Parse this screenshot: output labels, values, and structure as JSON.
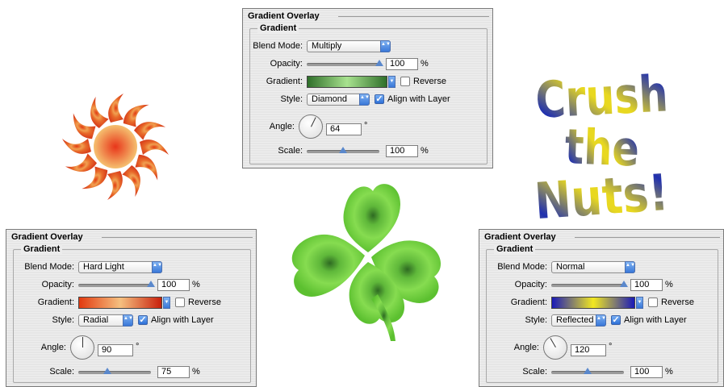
{
  "panels": [
    {
      "title": "Gradient Overlay",
      "group": "Gradient",
      "blend_label": "Blend Mode:",
      "blend_mode": "Multiply",
      "opacity_label": "Opacity:",
      "opacity": "100",
      "opacity_pct": 1.0,
      "opacity_unit": "%",
      "gradient_label": "Gradient:",
      "gradient_colors": [
        "#2f6f2a",
        "#a8e28f",
        "#2f6f2a"
      ],
      "reverse_label": "Reverse",
      "reverse_checked": false,
      "style_label": "Style:",
      "style": "Diamond",
      "align_label": "Align with Layer",
      "align_checked": true,
      "angle_label": "Angle:",
      "angle": "64",
      "degree": "°",
      "scale_label": "Scale:",
      "scale": "100",
      "scale_pct": 0.5,
      "scale_unit": "%"
    },
    {
      "title": "Gradient Overlay",
      "group": "Gradient",
      "blend_label": "Blend Mode:",
      "blend_mode": "Hard Light",
      "opacity_label": "Opacity:",
      "opacity": "100",
      "opacity_pct": 1.0,
      "opacity_unit": "%",
      "gradient_label": "Gradient:",
      "gradient_colors": [
        "#e23a10",
        "#f5c080",
        "#c8200c"
      ],
      "reverse_label": "Reverse",
      "reverse_checked": false,
      "style_label": "Style:",
      "style": "Radial",
      "align_label": "Align with Layer",
      "align_checked": true,
      "angle_label": "Angle:",
      "angle": "90",
      "degree": "°",
      "scale_label": "Scale:",
      "scale": "75",
      "scale_pct": 0.4,
      "scale_unit": "%"
    },
    {
      "title": "Gradient Overlay",
      "group": "Gradient",
      "blend_label": "Blend Mode:",
      "blend_mode": "Normal",
      "opacity_label": "Opacity:",
      "opacity": "100",
      "opacity_pct": 1.0,
      "opacity_unit": "%",
      "gradient_label": "Gradient:",
      "gradient_colors": [
        "#1a1ab8",
        "#f2e820",
        "#1a1ab8"
      ],
      "reverse_label": "Reverse",
      "reverse_checked": false,
      "style_label": "Style:",
      "style": "Reflected",
      "align_label": "Align with Layer",
      "align_checked": true,
      "angle_label": "Angle:",
      "angle": "120",
      "degree": "°",
      "scale_label": "Scale:",
      "scale": "100",
      "scale_pct": 0.5,
      "scale_unit": "%"
    }
  ],
  "artwork": {
    "crush_lines": [
      "Crush",
      "the",
      "Nuts!"
    ],
    "crush_colors": [
      "#1f2fb0",
      "#e8d820"
    ],
    "sun_colors": [
      "#d8401c",
      "#f4c070"
    ],
    "clover_colors": [
      "#2e6a22",
      "#7ed84a"
    ]
  }
}
